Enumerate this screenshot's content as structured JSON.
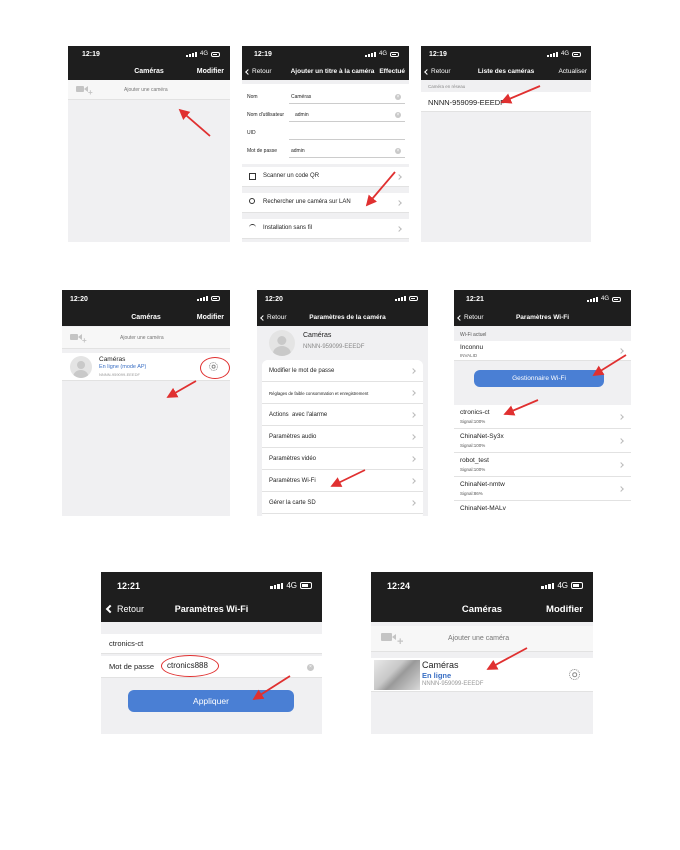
{
  "accent_color": "#4a7fd4",
  "arrow_color": "#e03030",
  "status_network": "4G",
  "s1": {
    "time": "12:19",
    "title": "Caméras",
    "right": "Modifier",
    "add_label": "Ajouter une caméra"
  },
  "s2": {
    "time": "12:19",
    "back": "Retour",
    "title": "Ajouter un titre à la caméra",
    "right": "Effectué",
    "fields": [
      {
        "label": "Nom",
        "value": "Caméras"
      },
      {
        "label": "Nom d'utilisateur",
        "value": "admin"
      },
      {
        "label": "UID",
        "value": ""
      },
      {
        "label": "Mot de passe",
        "value": "admin"
      }
    ],
    "actions": [
      "Scanner un code QR",
      "Rechercher une caméra sur LAN",
      "Installation sans fil"
    ]
  },
  "s3": {
    "time": "12:19",
    "back": "Retour",
    "title": "Liste des caméras",
    "right": "Actualiser",
    "section": "Caméra en réseau",
    "camera_uid": "NNNN-959099-EEEDF"
  },
  "s4": {
    "time": "12:20",
    "title": "Caméras",
    "right": "Modifier",
    "add_label": "Ajouter une caméra",
    "camera_name": "Caméras",
    "camera_status": "En ligne (mode AP)",
    "camera_uid": "NNNN-959099-EEEDF"
  },
  "s5": {
    "time": "12:20",
    "back": "Retour",
    "title": "Paramètres de la caméra",
    "camera_name": "Caméras",
    "camera_uid": "NNNN-959099-EEEDF",
    "items": [
      "Modifier le mot de passe",
      "Réglages de faible consommation et enregistrement",
      "Actions  avec l'alarme",
      "Paramètres audio",
      "Paramètres vidéo",
      "Paramètres Wi-Fi",
      "Gérer la carte SD"
    ]
  },
  "s6": {
    "time": "12:21",
    "back": "Retour",
    "title": "Paramètres Wi-Fi",
    "section": "Wi-Fi actuel",
    "current_name": "Inconnu",
    "current_status": "INVALID",
    "manager_button": "Gestionnaire Wi-Fi",
    "networks": [
      {
        "name": "ctronics-ct",
        "signal": "Signal:100%"
      },
      {
        "name": "ChinaNet-Sy3x",
        "signal": "Signal:100%"
      },
      {
        "name": "robot_test",
        "signal": "Signal:100%"
      },
      {
        "name": "ChinaNet-nmtw",
        "signal": "Signal:86%"
      },
      {
        "name": "ChinaNet-MALv",
        "signal": ""
      }
    ]
  },
  "s7": {
    "time": "12:21",
    "back": "Retour",
    "title": "Paramètres Wi-Fi",
    "ssid": "ctronics-ct",
    "password_label": "Mot de passe",
    "password_value": "ctronics888",
    "apply_button": "Appliquer"
  },
  "s8": {
    "time": "12:24",
    "title": "Caméras",
    "right": "Modifier",
    "add_label": "Ajouter une caméra",
    "camera_name": "Caméras",
    "camera_status": "En ligne",
    "camera_uid": "NNNN-959099-EEEDF"
  }
}
